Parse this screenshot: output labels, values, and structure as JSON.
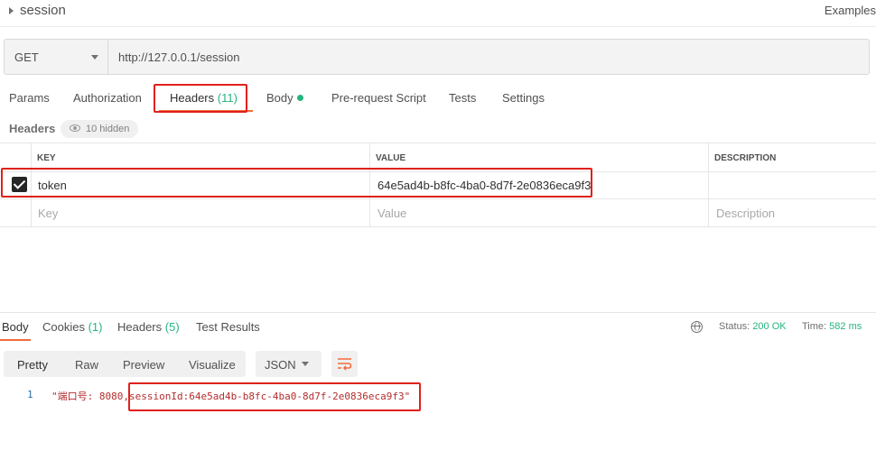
{
  "request": {
    "name": "session",
    "examples_label": "Examples",
    "method": "GET",
    "url": "http://127.0.0.1/session"
  },
  "request_tabs": [
    {
      "label": "Params"
    },
    {
      "label": "Authorization"
    },
    {
      "label": "Headers",
      "count": "(11)"
    },
    {
      "label": "Body"
    },
    {
      "label": "Pre-request Script"
    },
    {
      "label": "Tests"
    },
    {
      "label": "Settings"
    }
  ],
  "headers_section": {
    "title": "Headers",
    "hidden_label": "10 hidden"
  },
  "headers_table": {
    "columns": [
      "KEY",
      "VALUE",
      "DESCRIPTION"
    ],
    "rows": [
      {
        "checked": true,
        "key": "token",
        "value": "64e5ad4b-b8fc-4ba0-8d7f-2e0836eca9f3",
        "description": ""
      }
    ],
    "placeholders": {
      "key": "Key",
      "value": "Value",
      "description": "Description"
    }
  },
  "response_tabs": [
    {
      "label": "Body"
    },
    {
      "label": "Cookies",
      "count": "(1)"
    },
    {
      "label": "Headers",
      "count": "(5)"
    },
    {
      "label": "Test Results"
    }
  ],
  "response_status": {
    "status_label": "Status:",
    "status_value": "200 OK",
    "time_label": "Time:",
    "time_value": "582 ms"
  },
  "view_modes": [
    "Pretty",
    "Raw",
    "Preview",
    "Visualize"
  ],
  "format": "JSON",
  "response_body": {
    "line_number": "1",
    "text": "\"端口号: 8080,sessionId:64e5ad4b-b8fc-4ba0-8d7f-2e0836eca9f3\""
  },
  "colors": {
    "accent": "#f26b3a",
    "success": "#26b47f",
    "highlight_box": "#e0201b"
  }
}
